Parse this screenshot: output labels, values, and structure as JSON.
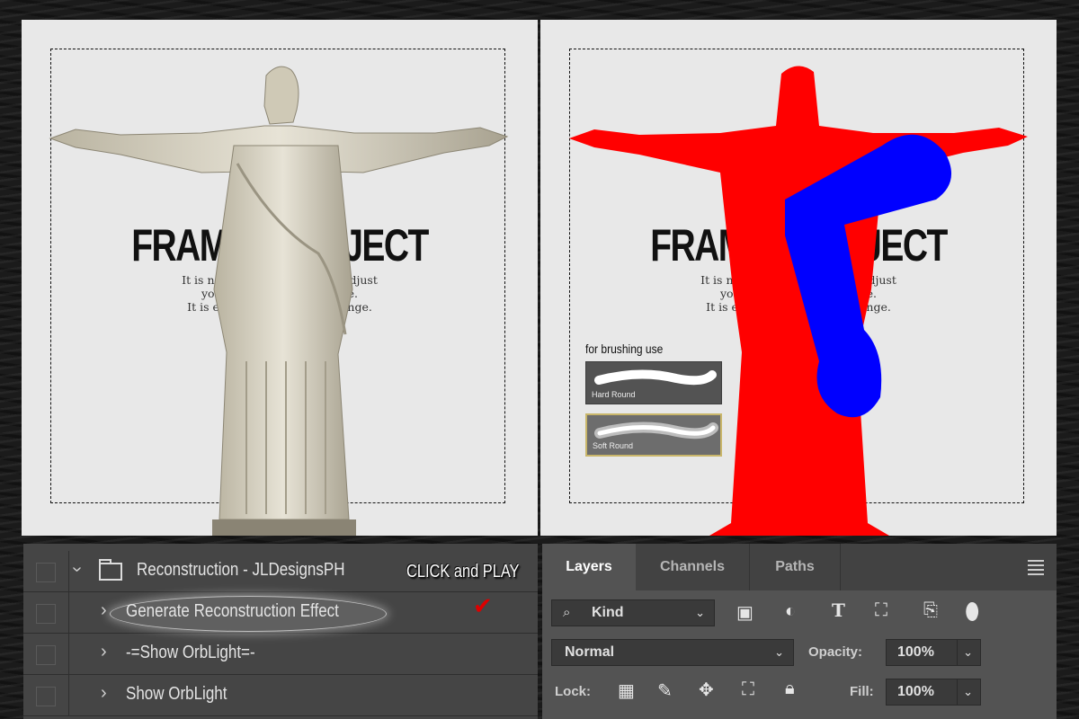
{
  "left_canvas": {
    "frame_title_left": "FRAM",
    "frame_title_right": "BJECT",
    "line1_left": "It is not",
    "line1_right": "adjust",
    "line2_left": "you",
    "line2_right": "e.",
    "line3_left": "It is enough",
    "line3_right": "its range."
  },
  "right_canvas": {
    "frame_title_left": "FRAM",
    "frame_title_right": "BJECT",
    "line1_left": "It is not",
    "line1_right": "adjust",
    "line2_left": "you",
    "line2_right": "e.",
    "line3_left": "It is enough",
    "line3_right": "its range.",
    "brush_label": "for brushing use",
    "brushes": [
      "Hard Round",
      "Soft Round"
    ],
    "colors": {
      "red": "#ff0000",
      "blue": "#0000ff"
    }
  },
  "actions": {
    "folder": "Reconstruction - JLDesignsPH",
    "items": [
      "Generate Reconstruction Effect",
      "-=Show OrbLight=-",
      "Show OrbLight"
    ],
    "annotation": "CLICK and PLAY"
  },
  "layers": {
    "tabs": [
      "Layers",
      "Channels",
      "Paths"
    ],
    "filter_kind": "Kind",
    "blend_mode": "Normal",
    "opacity_label": "Opacity:",
    "opacity_value": "100%",
    "lock_label": "Lock:",
    "fill_label": "Fill:",
    "fill_value": "100%"
  }
}
